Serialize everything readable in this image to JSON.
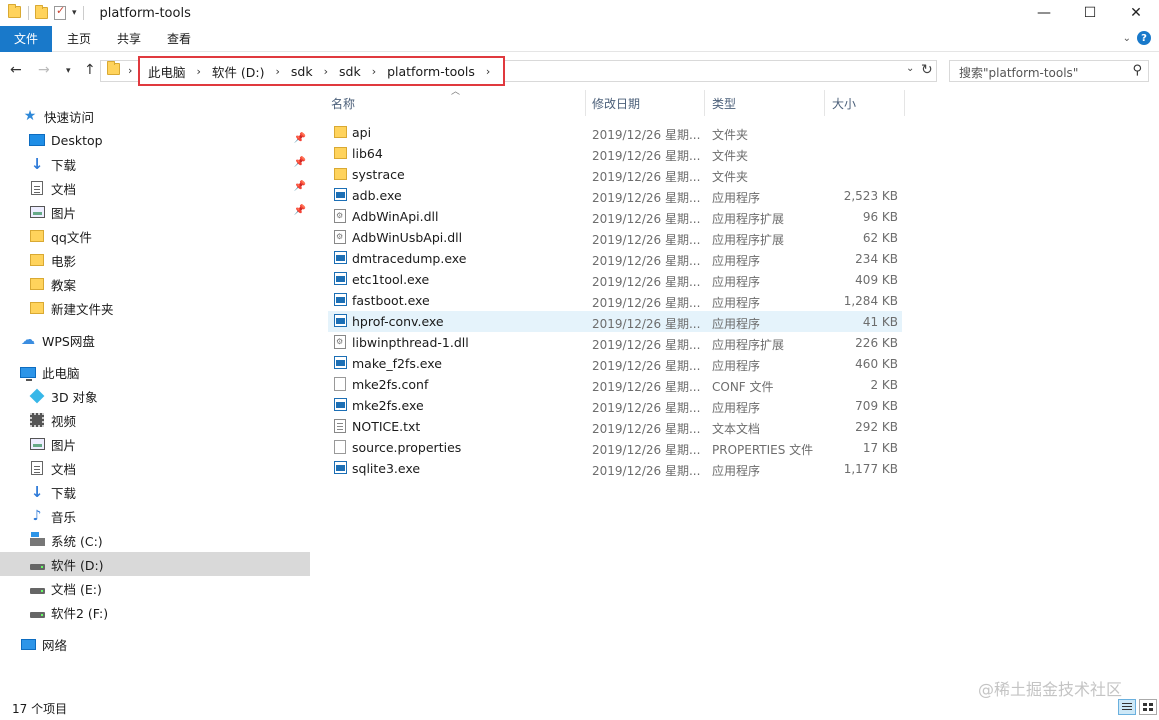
{
  "window": {
    "title": "platform-tools",
    "controls": {
      "minimize": "—",
      "maximize": "☐",
      "close": "✕"
    }
  },
  "ribbon": {
    "tabs": [
      "文件",
      "主页",
      "共享",
      "查看"
    ]
  },
  "address": {
    "crumbs": [
      "此电脑",
      "软件 (D:)",
      "sdk",
      "sdk",
      "platform-tools"
    ],
    "highlight_color": "#e0393e"
  },
  "search": {
    "placeholder": "搜索\"platform-tools\""
  },
  "sidebar": {
    "items": [
      {
        "label": "快速访问",
        "icon": "star-icon",
        "pinned": false
      },
      {
        "label": "Desktop",
        "icon": "desktop-icon",
        "pinned": true
      },
      {
        "label": "下载",
        "icon": "download-icon",
        "pinned": true
      },
      {
        "label": "文档",
        "icon": "document-icon",
        "pinned": true
      },
      {
        "label": "图片",
        "icon": "picture-icon",
        "pinned": true
      },
      {
        "label": "qq文件",
        "icon": "folder-icon",
        "pinned": false
      },
      {
        "label": "电影",
        "icon": "folder-icon",
        "pinned": false
      },
      {
        "label": "教案",
        "icon": "folder-icon",
        "pinned": false
      },
      {
        "label": "新建文件夹",
        "icon": "folder-icon",
        "pinned": false
      },
      {
        "label": "WPS网盘",
        "icon": "cloud-icon",
        "pinned": false
      },
      {
        "label": "此电脑",
        "icon": "computer-icon",
        "pinned": false
      },
      {
        "label": "3D 对象",
        "icon": "3d-objects-icon",
        "pinned": false
      },
      {
        "label": "视频",
        "icon": "video-icon",
        "pinned": false
      },
      {
        "label": "图片",
        "icon": "picture-icon",
        "pinned": false
      },
      {
        "label": "文档",
        "icon": "document-icon",
        "pinned": false
      },
      {
        "label": "下载",
        "icon": "download-icon",
        "pinned": false
      },
      {
        "label": "音乐",
        "icon": "music-icon",
        "pinned": false
      },
      {
        "label": "系统 (C:)",
        "icon": "system-drive-icon",
        "pinned": false
      },
      {
        "label": "软件 (D:)",
        "icon": "drive-icon",
        "pinned": false,
        "selected": true
      },
      {
        "label": "文档 (E:)",
        "icon": "drive-icon",
        "pinned": false
      },
      {
        "label": "软件2 (F:)",
        "icon": "drive-icon",
        "pinned": false
      },
      {
        "label": "网络",
        "icon": "network-icon",
        "pinned": false
      }
    ]
  },
  "columns": {
    "name": "名称",
    "date": "修改日期",
    "type": "类型",
    "size": "大小"
  },
  "files": [
    {
      "name": "api",
      "date": "2019/12/26 星期...",
      "type": "文件夹",
      "size": "",
      "icon": "folder-icon"
    },
    {
      "name": "lib64",
      "date": "2019/12/26 星期...",
      "type": "文件夹",
      "size": "",
      "icon": "folder-icon"
    },
    {
      "name": "systrace",
      "date": "2019/12/26 星期...",
      "type": "文件夹",
      "size": "",
      "icon": "folder-icon"
    },
    {
      "name": "adb.exe",
      "date": "2019/12/26 星期...",
      "type": "应用程序",
      "size": "2,523 KB",
      "icon": "exe-icon"
    },
    {
      "name": "AdbWinApi.dll",
      "date": "2019/12/26 星期...",
      "type": "应用程序扩展",
      "size": "96 KB",
      "icon": "dll-icon"
    },
    {
      "name": "AdbWinUsbApi.dll",
      "date": "2019/12/26 星期...",
      "type": "应用程序扩展",
      "size": "62 KB",
      "icon": "dll-icon"
    },
    {
      "name": "dmtracedump.exe",
      "date": "2019/12/26 星期...",
      "type": "应用程序",
      "size": "234 KB",
      "icon": "exe-icon"
    },
    {
      "name": "etc1tool.exe",
      "date": "2019/12/26 星期...",
      "type": "应用程序",
      "size": "409 KB",
      "icon": "exe-icon"
    },
    {
      "name": "fastboot.exe",
      "date": "2019/12/26 星期...",
      "type": "应用程序",
      "size": "1,284 KB",
      "icon": "exe-icon"
    },
    {
      "name": "hprof-conv.exe",
      "date": "2019/12/26 星期...",
      "type": "应用程序",
      "size": "41 KB",
      "icon": "exe-icon",
      "hover": true
    },
    {
      "name": "libwinpthread-1.dll",
      "date": "2019/12/26 星期...",
      "type": "应用程序扩展",
      "size": "226 KB",
      "icon": "dll-icon"
    },
    {
      "name": "make_f2fs.exe",
      "date": "2019/12/26 星期...",
      "type": "应用程序",
      "size": "460 KB",
      "icon": "exe-icon"
    },
    {
      "name": "mke2fs.conf",
      "date": "2019/12/26 星期...",
      "type": "CONF 文件",
      "size": "2 KB",
      "icon": "file-icon"
    },
    {
      "name": "mke2fs.exe",
      "date": "2019/12/26 星期...",
      "type": "应用程序",
      "size": "709 KB",
      "icon": "exe-icon"
    },
    {
      "name": "NOTICE.txt",
      "date": "2019/12/26 星期...",
      "type": "文本文档",
      "size": "292 KB",
      "icon": "text-file-icon"
    },
    {
      "name": "source.properties",
      "date": "2019/12/26 星期...",
      "type": "PROPERTIES 文件",
      "size": "17 KB",
      "icon": "file-icon"
    },
    {
      "name": "sqlite3.exe",
      "date": "2019/12/26 星期...",
      "type": "应用程序",
      "size": "1,177 KB",
      "icon": "exe-icon"
    }
  ],
  "status": {
    "count": "17 个项目"
  },
  "watermark": "@稀土掘金技术社区"
}
